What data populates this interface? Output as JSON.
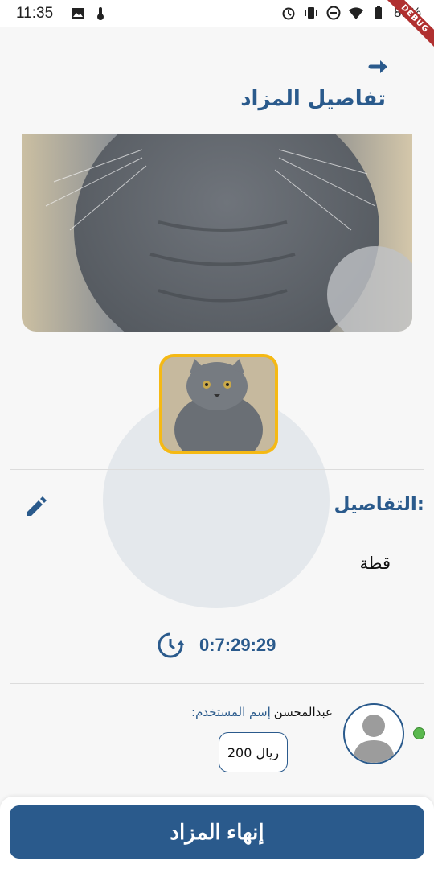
{
  "status_bar": {
    "time": "11:35",
    "battery": "83%",
    "left_icons": [
      "image-icon",
      "thermometer-icon"
    ],
    "right_icons": [
      "alarm-icon",
      "vibrate-icon",
      "dnd-icon",
      "wifi-icon",
      "battery-icon"
    ]
  },
  "debug_banner": "DEBUG",
  "header": {
    "title": "تفاصيل المزاد",
    "back_icon": "arrow-right-icon"
  },
  "details": {
    "label": "التفاصيل:",
    "value": "قطة",
    "edit_icon": "pencil-icon"
  },
  "timer": {
    "text": "0:7:29:29",
    "icon": "timer-icon"
  },
  "bidder": {
    "name_key": "إسم المستخدم:",
    "name": "عبدالمحسن",
    "amount": "200 ريال",
    "online_status_color": "#5ab84e"
  },
  "actions": {
    "end_auction": "إنهاء المزاد"
  },
  "colors": {
    "primary": "#2a5a8c",
    "thumb_border": "#f5b914"
  }
}
